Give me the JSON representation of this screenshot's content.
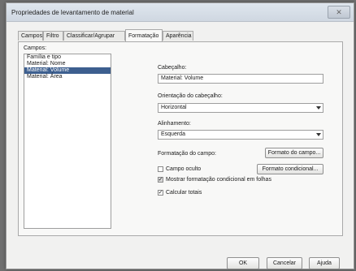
{
  "dialog": {
    "title": "Propriedades de levantamento de material",
    "close_glyph": "✕"
  },
  "tabs": [
    {
      "label": "Campos"
    },
    {
      "label": "Filtro"
    },
    {
      "label": "Classificar/Agrupar"
    },
    {
      "label": "Formatação"
    },
    {
      "label": "Aparência"
    }
  ],
  "fields": {
    "label": "Campos:",
    "items": [
      {
        "label": "Família e tipo"
      },
      {
        "label": "Material: Nome"
      },
      {
        "label": "Material: Volume"
      },
      {
        "label": "Material: Área"
      }
    ]
  },
  "heading": {
    "label": "Cabeçalho:",
    "value": "Material: Volume"
  },
  "orientation": {
    "label": "Orientação do cabeçalho:",
    "value": "Horizontal"
  },
  "alignment": {
    "label": "Alinhamento:",
    "value": "Esquerda"
  },
  "formatting": {
    "label": "Formatação do campo:",
    "format_button": "Formato do campo...",
    "conditional_button": "Formato condicional..."
  },
  "checks": {
    "hidden": {
      "label": "Campo oculto",
      "checked": false
    },
    "show_conditional": {
      "label": "Mostrar formatação condicional em folhas",
      "checked": true
    },
    "totals": {
      "label": "Calcular totais",
      "checked": true
    }
  },
  "buttons": {
    "ok": "OK",
    "cancel": "Cancelar",
    "help": "Ajuda"
  }
}
